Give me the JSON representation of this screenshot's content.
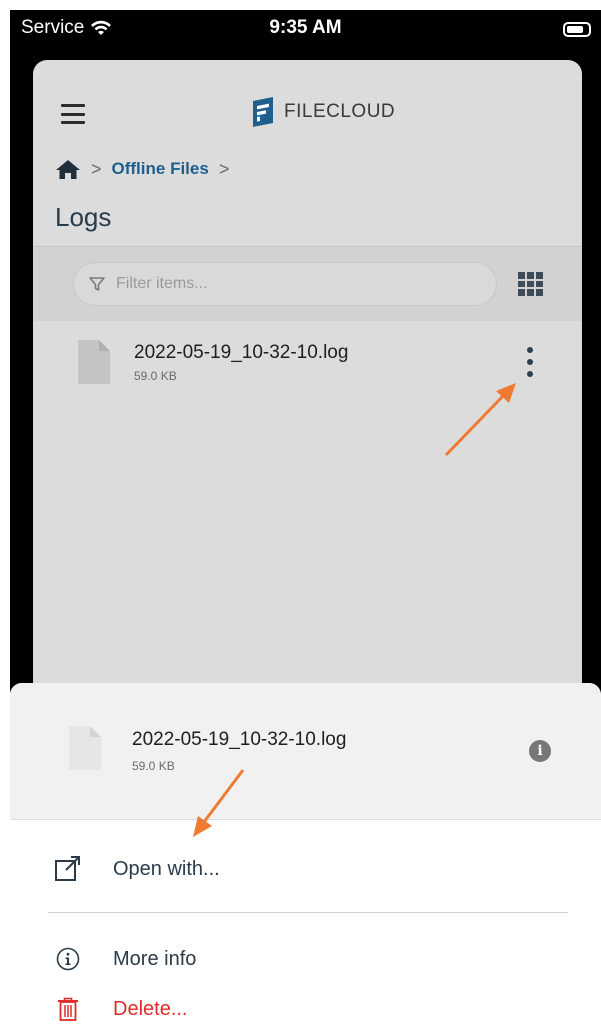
{
  "status_bar": {
    "carrier": "Service",
    "time": "9:35 AM"
  },
  "header": {
    "brand": "FILECLOUD",
    "breadcrumb": {
      "home_icon": "home-icon",
      "link": "Offline Files"
    },
    "title": "Logs"
  },
  "filter": {
    "placeholder": "Filter items..."
  },
  "files": [
    {
      "name": "2022-05-19_10-32-10.log",
      "size": "59.0 KB"
    }
  ],
  "action_sheet": {
    "file": {
      "name": "2022-05-19_10-32-10.log",
      "size": "59.0 KB"
    },
    "items": [
      {
        "label": "Open with...",
        "icon": "open-external-icon"
      },
      {
        "label": "More info",
        "icon": "info-icon"
      },
      {
        "label": "Delete...",
        "icon": "trash-icon"
      }
    ]
  },
  "colors": {
    "brand": "#1e5f8e",
    "danger": "#e02b2b",
    "annotation": "#f07a30"
  }
}
